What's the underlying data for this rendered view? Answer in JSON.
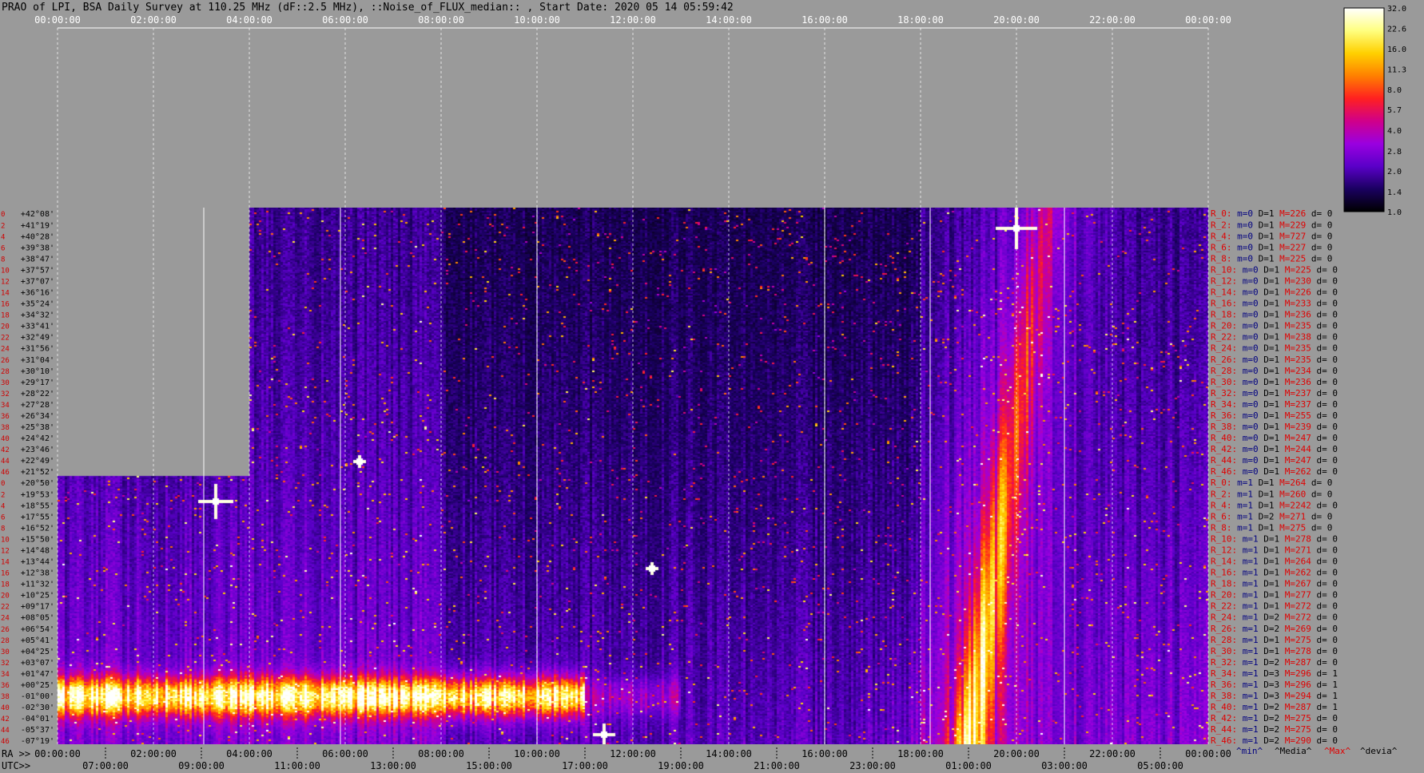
{
  "title": "PRAO of LPI, BSA Daily Survey at 110.25 MHz (dF::2.5 MHz), ::Noise_of_FLUX_median:: , Start Date: 2020 05 14 05:59:42",
  "chart_data": {
    "type": "heatmap",
    "top_axis_ticks": [
      "00:00:00",
      "02:00:00",
      "04:00:00",
      "06:00:00",
      "08:00:00",
      "10:00:00",
      "12:00:00",
      "14:00:00",
      "16:00:00",
      "18:00:00",
      "20:00:00",
      "22:00:00",
      "00:00:00"
    ],
    "ra_prefix": "RA >>",
    "utc_prefix": "UTC>>",
    "ra_ticks": [
      "00:00:00",
      "02:00:00",
      "04:00:00",
      "06:00:00",
      "08:00:00",
      "10:00:00",
      "12:00:00",
      "14:00:00",
      "16:00:00",
      "18:00:00",
      "20:00:00",
      "22:00:00",
      "00:00:00"
    ],
    "utc_ticks": [
      "07:00:00",
      "09:00:00",
      "11:00:00",
      "13:00:00",
      "15:00:00",
      "17:00:00",
      "19:00:00",
      "21:00:00",
      "23:00:00",
      "01:00:00",
      "03:00:00",
      "05:00:00"
    ],
    "declinations": [
      "+42°08'",
      "+41°19'",
      "+40°28'",
      "+39°38'",
      "+38°47'",
      "+37°57'",
      "+37°07'",
      "+36°16'",
      "+35°24'",
      "+34°32'",
      "+33°41'",
      "+32°49'",
      "+31°56'",
      "+31°04'",
      "+30°10'",
      "+29°17'",
      "+28°22'",
      "+27°28'",
      "+26°34'",
      "+25°38'",
      "+24°42'",
      "+23°46'",
      "+22°49'",
      "+21°52'",
      "+20°50'",
      "+19°53'",
      "+18°55'",
      "+17°55'",
      "+16°52'",
      "+15°50'",
      "+14°48'",
      "+13°44'",
      "+12°38'",
      "+11°32'",
      "+10°25'",
      "+09°17'",
      "+08°05'",
      "+06°54'",
      "+05°41'",
      "+04°25'",
      "+03°07'",
      "+01°47'",
      "+00°25'",
      "-01°00'",
      "-02°30'",
      "-04°01'",
      "-05°37'",
      "-07°19'"
    ],
    "row_numbers": [
      "0",
      "2",
      "4",
      "6",
      "8",
      "10",
      "12",
      "14",
      "16",
      "18",
      "20",
      "22",
      "24",
      "26",
      "28",
      "30",
      "32",
      "34",
      "36",
      "38",
      "40",
      "42",
      "44",
      "46",
      "0",
      "2",
      "4",
      "6",
      "8",
      "10",
      "12",
      "14",
      "16",
      "18",
      "20",
      "22",
      "24",
      "26",
      "28",
      "30",
      "32",
      "34",
      "36",
      "38",
      "40",
      "42",
      "44",
      "46"
    ],
    "row_stats": [
      {
        "r": "R_0:",
        "m": "m=0",
        "D": "D=1",
        "M": "M=226",
        "d": "d= 0"
      },
      {
        "r": "R_2:",
        "m": "m=0",
        "D": "D=1",
        "M": "M=229",
        "d": "d= 0"
      },
      {
        "r": "R_4:",
        "m": "m=0",
        "D": "D=1",
        "M": "M=727",
        "d": "d= 0"
      },
      {
        "r": "R_6:",
        "m": "m=0",
        "D": "D=1",
        "M": "M=227",
        "d": "d= 0"
      },
      {
        "r": "R_8:",
        "m": "m=0",
        "D": "D=1",
        "M": "M=225",
        "d": "d= 0"
      },
      {
        "r": "R_10:",
        "m": "m=0",
        "D": "D=1",
        "M": "M=225",
        "d": "d= 0"
      },
      {
        "r": "R_12:",
        "m": "m=0",
        "D": "D=1",
        "M": "M=230",
        "d": "d= 0"
      },
      {
        "r": "R_14:",
        "m": "m=0",
        "D": "D=1",
        "M": "M=226",
        "d": "d= 0"
      },
      {
        "r": "R_16:",
        "m": "m=0",
        "D": "D=1",
        "M": "M=233",
        "d": "d= 0"
      },
      {
        "r": "R_18:",
        "m": "m=0",
        "D": "D=1",
        "M": "M=236",
        "d": "d= 0"
      },
      {
        "r": "R_20:",
        "m": "m=0",
        "D": "D=1",
        "M": "M=235",
        "d": "d= 0"
      },
      {
        "r": "R_22:",
        "m": "m=0",
        "D": "D=1",
        "M": "M=238",
        "d": "d= 0"
      },
      {
        "r": "R_24:",
        "m": "m=0",
        "D": "D=1",
        "M": "M=235",
        "d": "d= 0"
      },
      {
        "r": "R_26:",
        "m": "m=0",
        "D": "D=1",
        "M": "M=235",
        "d": "d= 0"
      },
      {
        "r": "R_28:",
        "m": "m=0",
        "D": "D=1",
        "M": "M=234",
        "d": "d= 0"
      },
      {
        "r": "R_30:",
        "m": "m=0",
        "D": "D=1",
        "M": "M=236",
        "d": "d= 0"
      },
      {
        "r": "R_32:",
        "m": "m=0",
        "D": "D=1",
        "M": "M=237",
        "d": "d= 0"
      },
      {
        "r": "R_34:",
        "m": "m=0",
        "D": "D=1",
        "M": "M=237",
        "d": "d= 0"
      },
      {
        "r": "R_36:",
        "m": "m=0",
        "D": "D=1",
        "M": "M=255",
        "d": "d= 0"
      },
      {
        "r": "R_38:",
        "m": "m=0",
        "D": "D=1",
        "M": "M=239",
        "d": "d= 0"
      },
      {
        "r": "R_40:",
        "m": "m=0",
        "D": "D=1",
        "M": "M=247",
        "d": "d= 0"
      },
      {
        "r": "R_42:",
        "m": "m=0",
        "D": "D=1",
        "M": "M=244",
        "d": "d= 0"
      },
      {
        "r": "R_44:",
        "m": "m=0",
        "D": "D=1",
        "M": "M=247",
        "d": "d= 0"
      },
      {
        "r": "R_46:",
        "m": "m=0",
        "D": "D=1",
        "M": "M=262",
        "d": "d= 0"
      },
      {
        "r": "R_0:",
        "m": "m=1",
        "D": "D=1",
        "M": "M=264",
        "d": "d= 0"
      },
      {
        "r": "R_2:",
        "m": "m=1",
        "D": "D=1",
        "M": "M=260",
        "d": "d= 0"
      },
      {
        "r": "R_4:",
        "m": "m=1",
        "D": "D=1",
        "M": "M=2242",
        "d": "d= 0"
      },
      {
        "r": "R_6:",
        "m": "m=1",
        "D": "D=2",
        "M": "M=271",
        "d": "d= 0"
      },
      {
        "r": "R_8:",
        "m": "m=1",
        "D": "D=1",
        "M": "M=275",
        "d": "d= 0"
      },
      {
        "r": "R_10:",
        "m": "m=1",
        "D": "D=1",
        "M": "M=278",
        "d": "d= 0"
      },
      {
        "r": "R_12:",
        "m": "m=1",
        "D": "D=1",
        "M": "M=271",
        "d": "d= 0"
      },
      {
        "r": "R_14:",
        "m": "m=1",
        "D": "D=1",
        "M": "M=264",
        "d": "d= 0"
      },
      {
        "r": "R_16:",
        "m": "m=1",
        "D": "D=1",
        "M": "M=262",
        "d": "d= 0"
      },
      {
        "r": "R_18:",
        "m": "m=1",
        "D": "D=1",
        "M": "M=267",
        "d": "d= 0"
      },
      {
        "r": "R_20:",
        "m": "m=1",
        "D": "D=1",
        "M": "M=277",
        "d": "d= 0"
      },
      {
        "r": "R_22:",
        "m": "m=1",
        "D": "D=1",
        "M": "M=272",
        "d": "d= 0"
      },
      {
        "r": "R_24:",
        "m": "m=1",
        "D": "D=2",
        "M": "M=272",
        "d": "d= 0"
      },
      {
        "r": "R_26:",
        "m": "m=1",
        "D": "D=2",
        "M": "M=269",
        "d": "d= 0"
      },
      {
        "r": "R_28:",
        "m": "m=1",
        "D": "D=1",
        "M": "M=275",
        "d": "d= 0"
      },
      {
        "r": "R_30:",
        "m": "m=1",
        "D": "D=1",
        "M": "M=278",
        "d": "d= 0"
      },
      {
        "r": "R_32:",
        "m": "m=1",
        "D": "D=2",
        "M": "M=287",
        "d": "d= 0"
      },
      {
        "r": "R_34:",
        "m": "m=1",
        "D": "D=3",
        "M": "M=296",
        "d": "d= 1"
      },
      {
        "r": "R_36:",
        "m": "m=1",
        "D": "D=3",
        "M": "M=296",
        "d": "d= 1"
      },
      {
        "r": "R_38:",
        "m": "m=1",
        "D": "D=3",
        "M": "M=294",
        "d": "d= 1"
      },
      {
        "r": "R_40:",
        "m": "m=1",
        "D": "D=2",
        "M": "M=287",
        "d": "d= 1"
      },
      {
        "r": "R_42:",
        "m": "m=1",
        "D": "D=2",
        "M": "M=275",
        "d": "d= 0"
      },
      {
        "r": "R_44:",
        "m": "m=1",
        "D": "D=2",
        "M": "M=275",
        "d": "d= 0"
      },
      {
        "r": "R_46:",
        "m": "m=1",
        "D": "D=2",
        "M": "M=290",
        "d": "d= 0"
      }
    ],
    "stat_legend": [
      "^min^",
      "^Media^",
      "^Max^",
      "^devia^"
    ],
    "colorbar_ticks": [
      "32.0",
      "22.6",
      "16.0",
      "11.3",
      "8.0",
      "5.7",
      "4.0",
      "2.8",
      "2.0",
      "1.4",
      "1.0"
    ],
    "colorbar_range": [
      1.0,
      32.0
    ],
    "colorbar_scale": "log",
    "colormap": [
      "#000000",
      "#1a0060",
      "#5a00c8",
      "#9a00e0",
      "#d0008a",
      "#ff2020",
      "#ff8000",
      "#ffd000",
      "#ffff80",
      "#ffffff"
    ],
    "colors": {
      "label_blue": "#000080",
      "label_red": "#e00000",
      "label_black": "#000000",
      "legend_min": "#000080",
      "legend_media": "#000000",
      "legend_max": "#e00000",
      "legend_devia": "#000000"
    }
  }
}
